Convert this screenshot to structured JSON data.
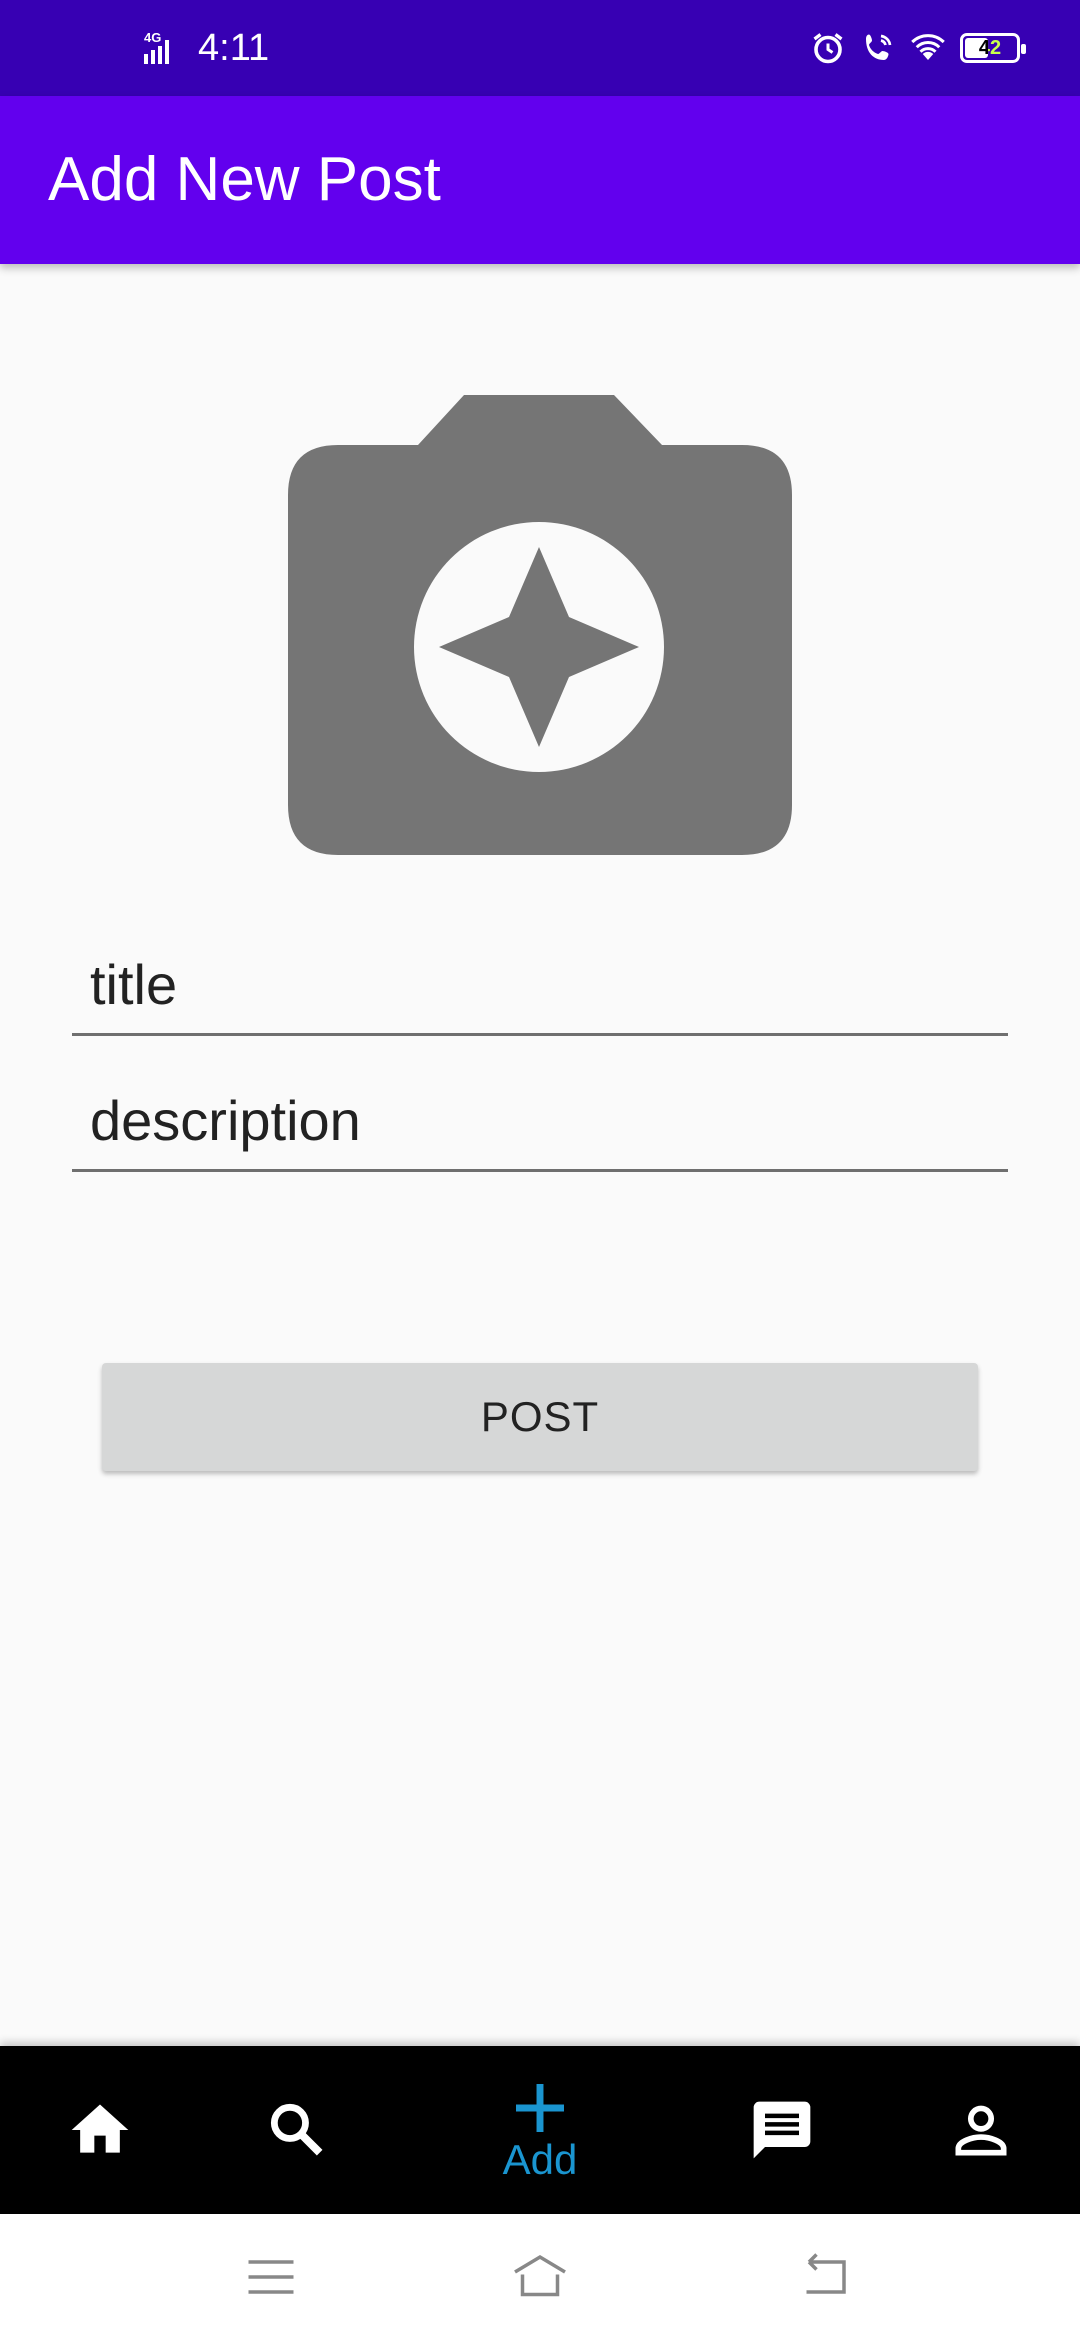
{
  "status_bar": {
    "network": "4G",
    "time": "4:11",
    "battery": "42",
    "icons": [
      "signal-icon",
      "alarm-icon",
      "wifi-calling-icon",
      "wifi-icon",
      "battery-icon"
    ]
  },
  "app_bar": {
    "title": "Add New Post"
  },
  "image_picker": {
    "icon": "camera-icon"
  },
  "form": {
    "title_placeholder": "title",
    "title_value": "",
    "description_placeholder": "description",
    "description_value": "",
    "post_label": "POST"
  },
  "bottom_nav": {
    "items": [
      {
        "icon": "home-icon",
        "label": ""
      },
      {
        "icon": "search-icon",
        "label": ""
      },
      {
        "icon": "add-icon",
        "label": "Add"
      },
      {
        "icon": "chat-icon",
        "label": ""
      },
      {
        "icon": "profile-icon",
        "label": ""
      }
    ],
    "active_color": "#1a95d0"
  },
  "system_nav": {
    "icons": [
      "menu-icon",
      "home-outline-icon",
      "back-icon"
    ]
  },
  "colors": {
    "status_bar": "#3700b3",
    "app_bar": "#6200ee",
    "background": "#fafafa",
    "button": "#d6d7d7",
    "camera": "#757575"
  }
}
